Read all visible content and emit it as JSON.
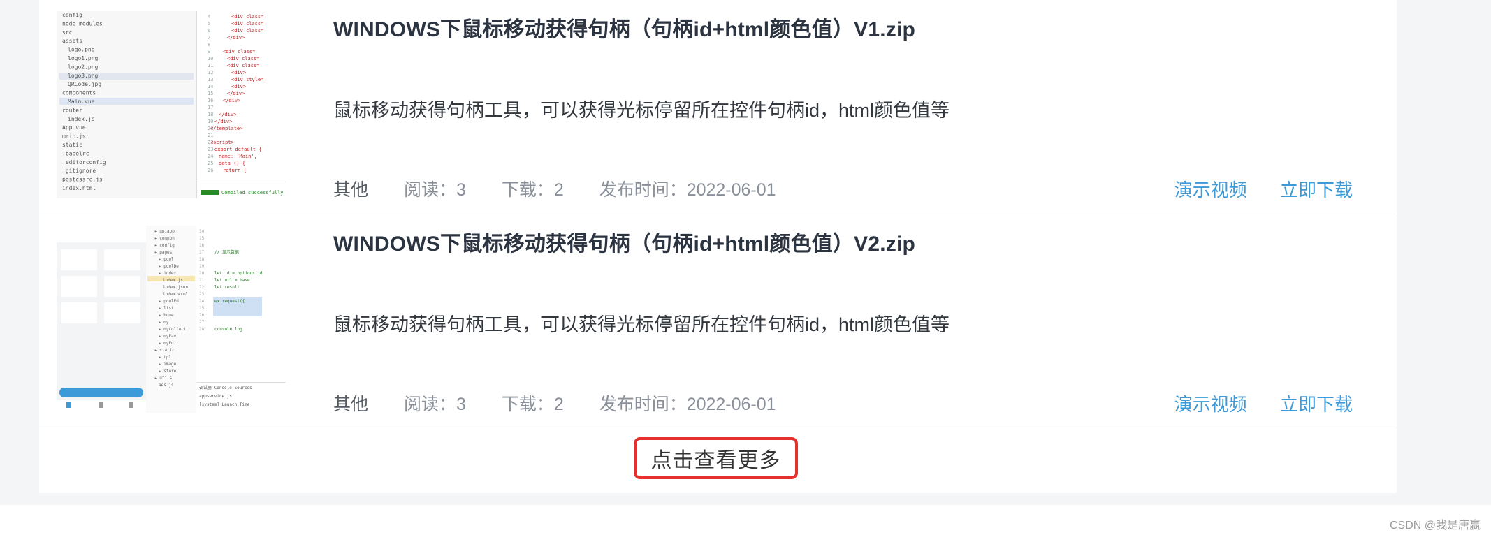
{
  "items": [
    {
      "title": "WINDOWS下鼠标移动获得句柄（句柄id+html颜色值）V1.zip",
      "description": "鼠标移动获得句柄工具，可以获得光标停留所在控件句柄id，html颜色值等",
      "category": "其他",
      "reads": "阅读：3",
      "downloads": "下载：2",
      "publish": "发布时间：2022-06-01",
      "demo": "演示视频",
      "download": "立即下载",
      "thumbnail_files": [
        "config",
        "node_modules",
        "src",
        "assets",
        "logo.png",
        "logo1.png",
        "logo2.png",
        "logo3.png",
        "QRCode.jpg",
        "components",
        "Main.vue",
        "router",
        "index.js",
        "App.vue",
        "main.js",
        "static",
        ".babelrc",
        ".editorconfig",
        ".gitignore",
        "postcssrc.js",
        "index.html"
      ]
    },
    {
      "title": "WINDOWS下鼠标移动获得句柄（句柄id+html颜色值）V2.zip",
      "description": "鼠标移动获得句柄工具，可以获得光标停留所在控件句柄id，html颜色值等",
      "category": "其他",
      "reads": "阅读：3",
      "downloads": "下载：2",
      "publish": "发布时间：2022-06-01",
      "demo": "演示视频",
      "download": "立即下载"
    }
  ],
  "more_button": "点击查看更多",
  "watermark": "CSDN @我是唐赢",
  "colors": {
    "link": "#3d9ad8",
    "highlight_border": "#e5302e",
    "title": "#2b3440"
  }
}
